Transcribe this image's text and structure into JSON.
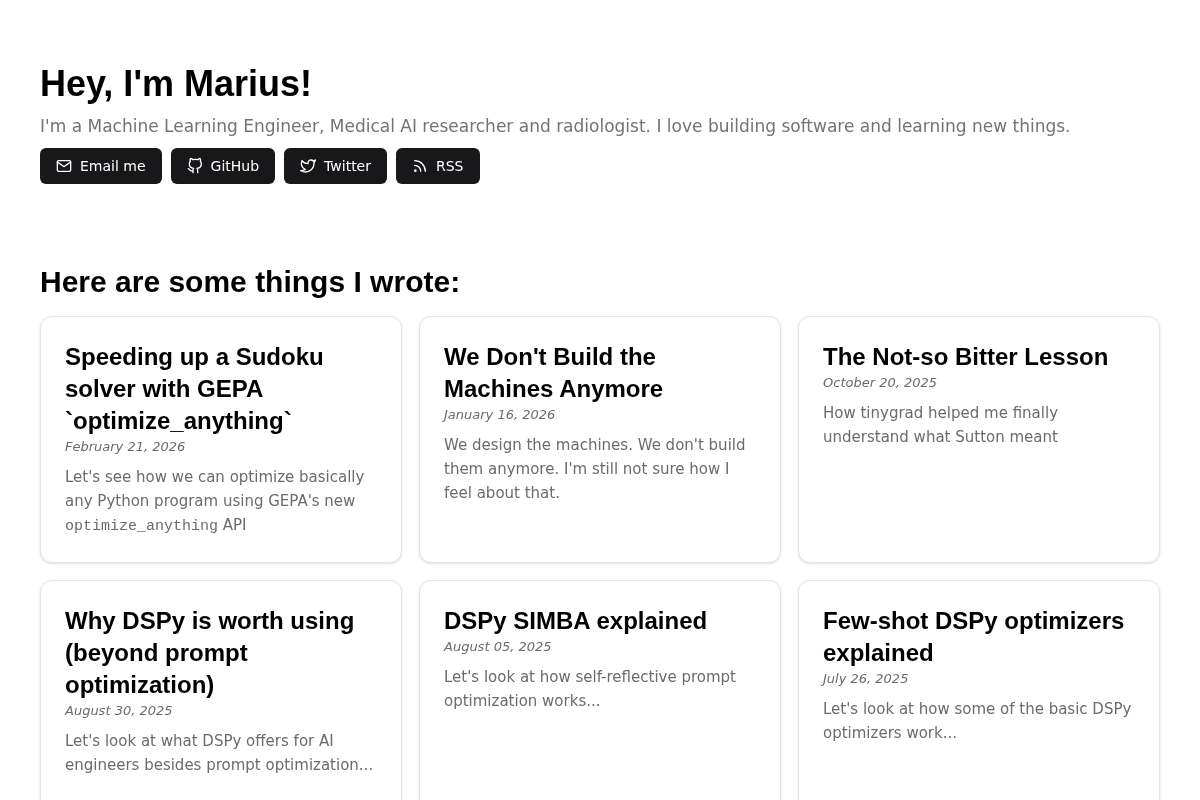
{
  "header": {
    "title": "Hey, I'm Marius!",
    "subtitle": "I'm a Machine Learning Engineer, Medical AI researcher and radiologist. I love building software and learning new things.",
    "links": [
      {
        "kind": "email",
        "label": "Email me"
      },
      {
        "kind": "github",
        "label": "GitHub"
      },
      {
        "kind": "twitter",
        "label": "Twitter"
      },
      {
        "kind": "rss",
        "label": "RSS"
      }
    ]
  },
  "posts": {
    "heading": "Here are some things I wrote:",
    "items": [
      {
        "title": "Speeding up a Sudoku solver with GEPA `optimize_anything`",
        "date": "February 21, 2026",
        "description": [
          {
            "kind": "text",
            "text": "Let's see how we can optimize basically any Python program using GEPA's new "
          },
          {
            "kind": "code",
            "text": "optimize_anything"
          },
          {
            "kind": "text",
            "text": " API"
          }
        ]
      },
      {
        "title": "We Don't Build the Machines Anymore",
        "date": "January 16, 2026",
        "description": [
          {
            "kind": "text",
            "text": "We design the machines. We don't build them anymore. I'm still not sure how I feel about that."
          }
        ]
      },
      {
        "title": "The Not-so Bitter Lesson",
        "date": "October 20, 2025",
        "description": [
          {
            "kind": "text",
            "text": "How tinygrad helped me finally understand what Sutton meant"
          }
        ]
      },
      {
        "title": "Why DSPy is worth using (beyond prompt optimization)",
        "date": "August 30, 2025",
        "description": [
          {
            "kind": "text",
            "text": "Let's look at what DSPy offers for AI engineers besides prompt optimization..."
          }
        ]
      },
      {
        "title": "DSPy SIMBA explained",
        "date": "August 05, 2025",
        "description": [
          {
            "kind": "text",
            "text": "Let's look at how self-reflective prompt optimization works..."
          }
        ]
      },
      {
        "title": "Few-shot DSPy optimizers explained",
        "date": "July 26, 2025",
        "description": [
          {
            "kind": "text",
            "text": "Let's look at how some of the basic DSPy optimizers work..."
          }
        ]
      }
    ]
  }
}
